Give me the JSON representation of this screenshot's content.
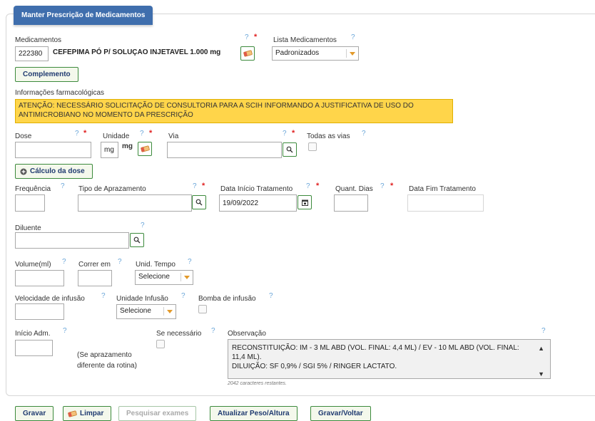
{
  "section_title": "Manter Prescrição de Medicamentos",
  "medicamentos": {
    "label": "Medicamentos",
    "code": "222380",
    "name": "CEFEPIMA PÓ P/ SOLUÇAO INJETAVEL 1.000 mg"
  },
  "lista": {
    "label": "Lista Medicamentos",
    "selected": "Padronizados"
  },
  "complemento_label": "Complemento",
  "info": {
    "label": "Informações farmacológicas",
    "warning": "ATENÇÃO: NECESSÁRIO SOLICITAÇÃO DE CONSULTORIA PARA A SCIH INFORMANDO A JUSTIFICATIVA DE USO DO ANTIMICROBIANO NO MOMENTO DA PRESCRIÇÃO"
  },
  "dose": {
    "label": "Dose"
  },
  "unidade": {
    "label": "Unidade",
    "value": "mg",
    "suffix": "mg"
  },
  "via": {
    "label": "Via"
  },
  "todas_vias_label": "Todas as vias",
  "calculo_label": "Cálculo da dose",
  "frequencia_label": "Frequência",
  "aprazamento_label": "Tipo de Aprazamento",
  "data_inicio": {
    "label": "Data Início Tratamento",
    "value": "19/09/2022"
  },
  "quant_dias_label": "Quant. Dias",
  "data_fim_label": "Data Fim Tratamento",
  "diluente_label": "Diluente",
  "volume_label": "Volume(ml)",
  "correr_label": "Correr em",
  "unid_tempo": {
    "label": "Unid. Tempo",
    "selected": "Selecione"
  },
  "velocidade_label": "Velocidade de infusão",
  "unid_infusao": {
    "label": "Unidade Infusão",
    "selected": "Selecione"
  },
  "bomba_label": "Bomba de infusão",
  "inicio_adm_label": "Início Adm.",
  "aprazamento_note": [
    "(Se aprazamento",
    "diferente da rotina)"
  ],
  "se_necessario_label": "Se necessário",
  "observacao": {
    "label": "Observação",
    "line1": "RECONSTITUIÇÃO: IM - 3 ML ABD (VOL. FINAL: 4,4 ML) / EV - 10 ML ABD (VOL. FINAL: 11,4 ML).",
    "line2": "DILUIÇÃO: SF 0,9% / SGI 5% / RINGER LACTATO.",
    "remaining": "2042 caracteres restantes."
  },
  "help_mark": "?",
  "required_mark": "*",
  "buttons": {
    "gravar": "Gravar",
    "limpar": "Limpar",
    "pesquisar": "Pesquisar exames",
    "atualizar": "Atualizar Peso/Altura",
    "gravar_voltar": "Gravar/Voltar"
  },
  "colors": {
    "legend_bg": "#3f6ead",
    "warning_bg": "#ffd54a",
    "button_border": "#3c8a3c",
    "help": "#6aa6d9",
    "required": "#e02020"
  },
  "icons": [
    "eraser-icon",
    "search-icon",
    "calendar-icon",
    "plus-circle-icon",
    "chevron-down-icon"
  ]
}
